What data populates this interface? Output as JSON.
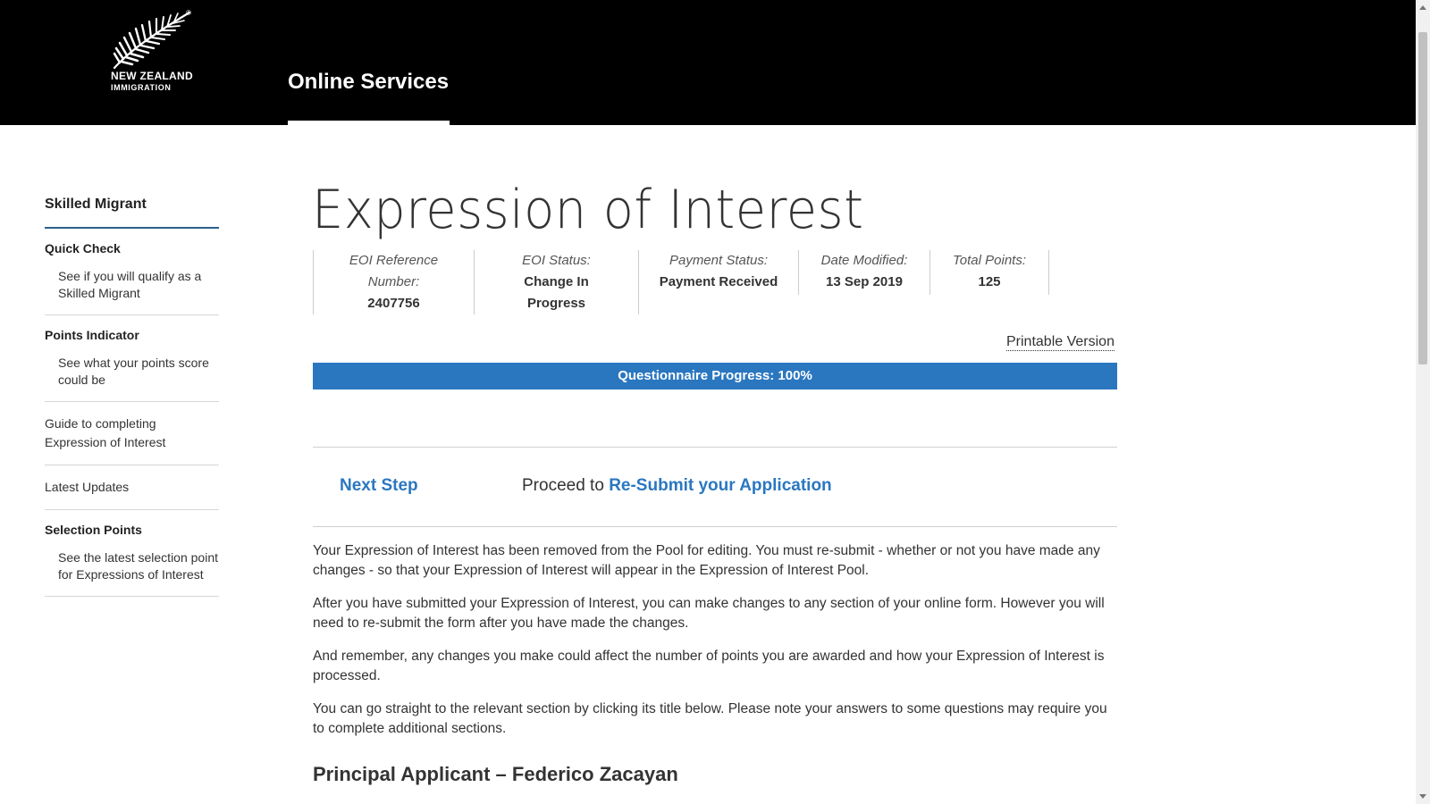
{
  "header": {
    "logo": {
      "line1": "NEW ZEALAND",
      "line2": "IMMIGRATION",
      "reg_mark": "®",
      "icon": "silver-fern-icon"
    },
    "nav_tab": "Online Services"
  },
  "sidebar": {
    "title": "Skilled Migrant",
    "sections": [
      {
        "heading": "Quick Check",
        "description": "See if you will qualify as a Skilled Migrant"
      },
      {
        "heading": "Points Indicator",
        "description": "See what your points score could be"
      },
      {
        "link": "Guide to completing Expression of Interest"
      },
      {
        "link": "Latest Updates"
      },
      {
        "heading": "Selection Points",
        "description": "See the latest selection point for Expressions of Interest"
      }
    ]
  },
  "main": {
    "title": "Expression of Interest",
    "meta": [
      {
        "label": "EOI Reference Number:",
        "value": "2407756"
      },
      {
        "label": "EOI Status:",
        "value": "Change In Progress"
      },
      {
        "label": "Payment Status:",
        "value": "Payment Received"
      },
      {
        "label": "Date Modified:",
        "value": "13 Sep 2019"
      },
      {
        "label": "Total Points:",
        "value": "125"
      }
    ],
    "printable_link": "Printable Version",
    "progress": {
      "label": "Questionnaire Progress: 100%",
      "value": 1.0
    },
    "next_step": {
      "label": "Next Step",
      "prefix": "Proceed to",
      "link": "Re-Submit your Application"
    },
    "paragraphs": [
      "Your Expression of Interest has been removed from the Pool for editing. You must re-submit - whether or not you have made any changes - so that your Expression of Interest will appear in the Expression of Interest Pool.",
      "After you have submitted your Expression of Interest, you can make changes to any section of your online form. However you will need to re-submit the form after you have made the changes.",
      "And remember, any changes you make could affect the number of points you are awarded and how your Expression of Interest is processed.",
      "You can go straight to the relevant section by clicking its title below. Please note your answers to some questions may require you to complete additional sections."
    ],
    "applicant_heading": "Principal Applicant – Federico Zacayan"
  },
  "colors": {
    "header_bg": "#000000",
    "accent_blue": "#2a77c0",
    "sidebar_rule": "#2b5f8c"
  }
}
